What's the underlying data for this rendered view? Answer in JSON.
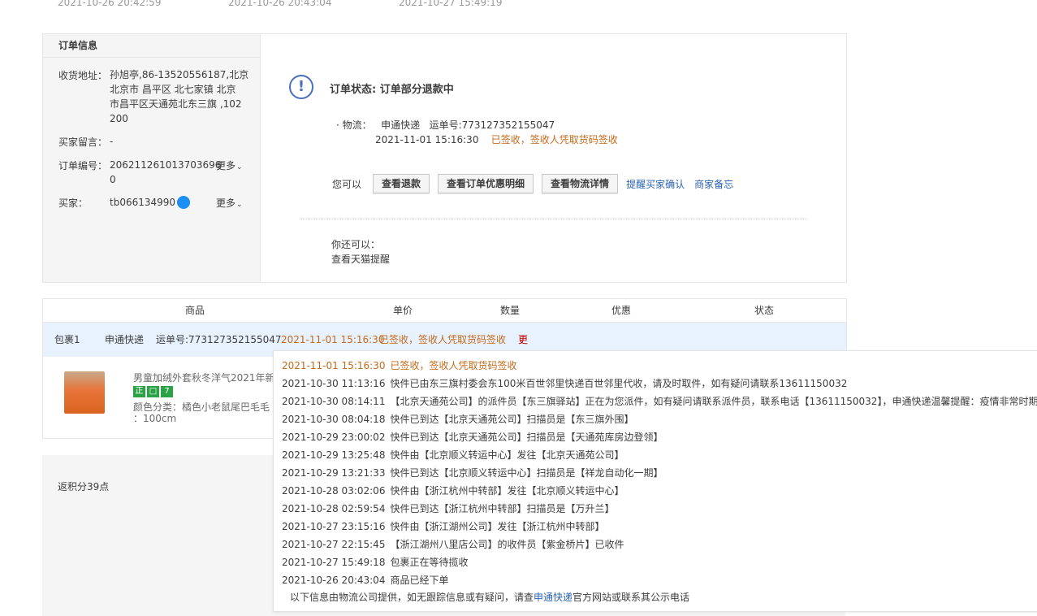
{
  "top_times": [
    "2021-10-26 20:42:59",
    "2021-10-26 20:43:04",
    "2021-10-27 15:49:19"
  ],
  "order_info": {
    "title": "订单信息",
    "address_label": "收货地址：",
    "address_lines": [
      "孙旭亭,86-13520556187,北京",
      "北京市 昌平区 北七家镇 北京",
      "市昌平区天通苑北东三旗 ,102",
      "200"
    ],
    "message_label": "买家留言：",
    "message_value": "-",
    "order_no_label": "订单编号：",
    "order_no_lines": [
      "206211261013703696",
      "0"
    ],
    "buyer_label": "买家：",
    "buyer_value": "tb066134990",
    "more": "更多"
  },
  "status": {
    "icon": "exclamation-circle-icon",
    "text": "订单状态: 订单部分退款中",
    "logistics_label": "· 物流：",
    "carrier": "申通快递",
    "tracking_label": "运单号:773127352155047",
    "time": "2021-11-01 15:16:30",
    "signed": "已签收，签收人凭取货码签收",
    "you_can": "您可以",
    "buttons": [
      "查看退款",
      "查看订单优惠明细",
      "查看物流详情"
    ],
    "links": [
      "提醒买家确认",
      "商家备忘"
    ],
    "can_also": "你还可以：",
    "reminder": "查看天猫提醒"
  },
  "product_table": {
    "headers": [
      "商品",
      "单价",
      "数量",
      "优惠",
      "状态"
    ],
    "package": {
      "label": "包裹1",
      "carrier": "申通快递",
      "tracking": "运单号:773127352155047",
      "time": "2021-11-01 15:16:30",
      "signed": "已签收，签收人凭取货码签收",
      "more": "更多"
    },
    "product": {
      "title": "男童加绒外套秋冬洋气2021年新",
      "badges": [
        "正",
        "",
        "7"
      ],
      "sku_line1": "颜色分类：橘色小老鼠尾巴毛毛",
      "sku_line2": "：100cm"
    }
  },
  "points": "返积分39点",
  "logistics_popup": {
    "entries": [
      {
        "time": "2021-11-01 15:16:30",
        "text": "已签收，签收人凭取货码签收"
      },
      {
        "time": "2021-10-30 11:13:16",
        "text": "快件已由东三旗村委会东100米百世邻里快递百世邻里代收，请及时取件，如有疑问请联系13611150032"
      },
      {
        "time": "2021-10-30 08:14:11",
        "text": "【北京天通苑公司】的派件员【东三旗驿站】正在为您派件，如有疑问请联系派件员，联系电话【13611150032】，申通快递温馨提醒：疫情非常时期，请"
      },
      {
        "time": "2021-10-30 08:04:18",
        "text": "快件已到达【北京天通苑公司】扫描员是【东三旗外围】"
      },
      {
        "time": "2021-10-29 23:00:02",
        "text": "快件已到达【北京天通苑公司】扫描员是【天通苑库房边登领】"
      },
      {
        "time": "2021-10-29 13:25:48",
        "text": "快件由【北京顺义转运中心】发往【北京天通苑公司】"
      },
      {
        "time": "2021-10-29 13:21:33",
        "text": "快件已到达【北京顺义转运中心】扫描员是【祥龙自动化一期】"
      },
      {
        "time": "2021-10-28 03:02:06",
        "text": "快件由【浙江杭州中转部】发往【北京顺义转运中心】"
      },
      {
        "time": "2021-10-28 02:59:54",
        "text": "快件已到达【浙江杭州中转部】扫描员是【万升兰】"
      },
      {
        "time": "2021-10-27 23:15:16",
        "text": "快件由【浙江湖州公司】发往【浙江杭州中转部】"
      },
      {
        "time": "2021-10-27 22:15:45",
        "text": "【浙江湖州八里店公司】的收件员【紫金桥片】已收件"
      },
      {
        "time": "2021-10-27 15:49:18",
        "text": "包裹正在等待揽收"
      },
      {
        "time": "2021-10-26 20:43:04",
        "text": "商品已经下单"
      }
    ],
    "footer_prefix": "以下信息由物流公司提供，如无跟踪信息或有疑问，请查",
    "footer_link": "申通快递",
    "footer_suffix": "官方网站或联系其公示电话"
  }
}
